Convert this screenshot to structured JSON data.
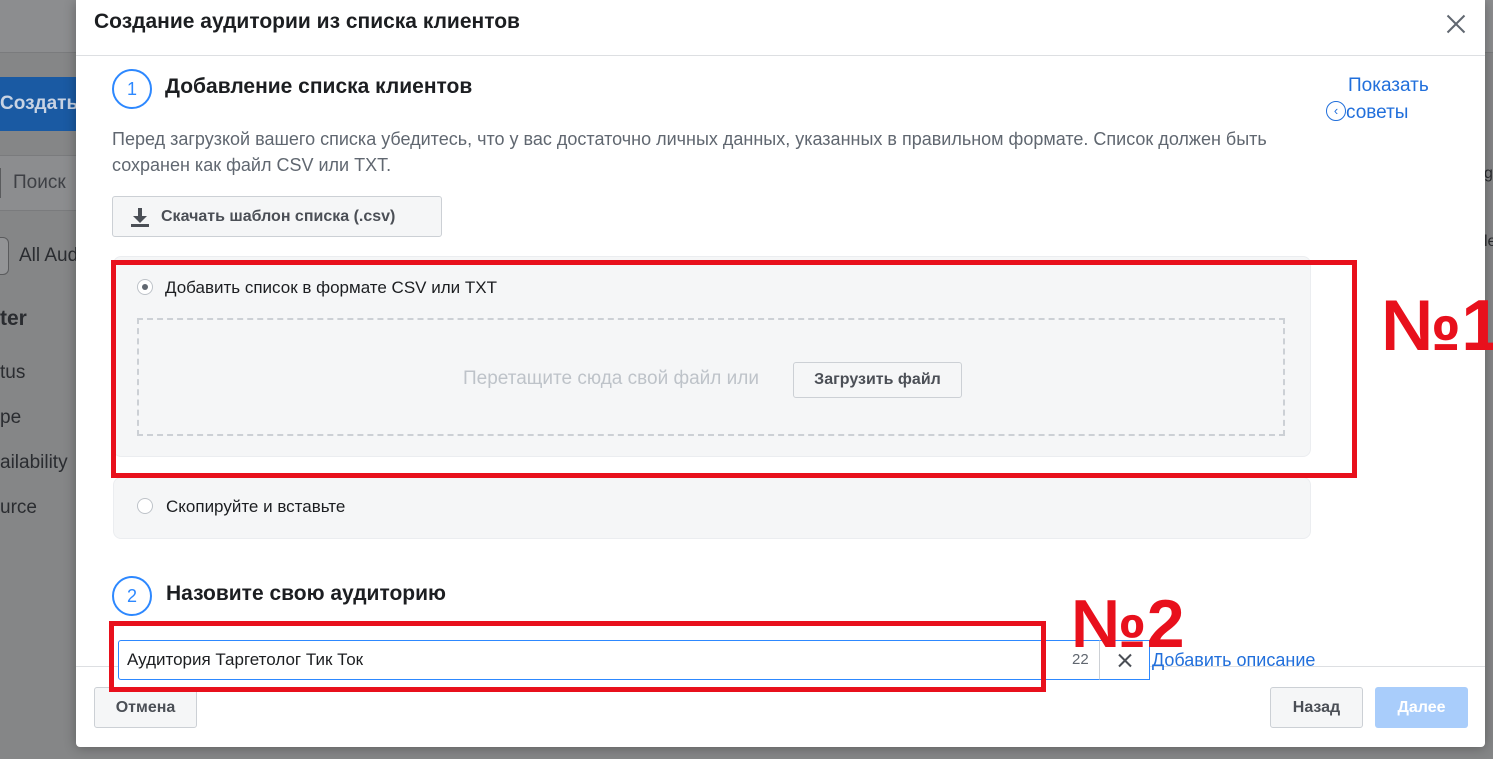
{
  "background": {
    "create_button": "Создать а",
    "search_placeholder": "Поиск",
    "all_audiences": "All Aud",
    "filter_heading": "ter",
    "filters": [
      "tus",
      "pe",
      "ailability",
      "urce"
    ],
    "right_edge_1": "ge",
    "right_edge_2": "le"
  },
  "dialog": {
    "title": "Создание аудитории из списка клиентов",
    "step1": {
      "number": "1",
      "title": "Добавление списка клиентов",
      "tips_line1": "Показать",
      "tips_line2": "советы",
      "intro": "Перед загрузкой вашего списка убедитесь, что у вас достаточно личных данных, указанных в правильном формате. Список должен быть сохранен как файл CSV или TXT.",
      "download_button": "Скачать шаблон списка (.csv)",
      "option_upload": "Добавить список в формате CSV или TXT",
      "drop_text": "Перетащите сюда свой файл или",
      "upload_button": "Загрузить файл",
      "option_paste": "Скопируйте и вставьте"
    },
    "step2": {
      "number": "2",
      "title": "Назовите свою аудиторию",
      "name_value": "Аудитория Таргетолог Тик Ток",
      "char_count": "22",
      "add_description": "Добавить описание"
    },
    "footer": {
      "cancel": "Отмена",
      "back": "Назад",
      "next": "Далее"
    }
  },
  "annotations": {
    "label1": "№1",
    "label2": "№2",
    "color": "#e8101c"
  }
}
